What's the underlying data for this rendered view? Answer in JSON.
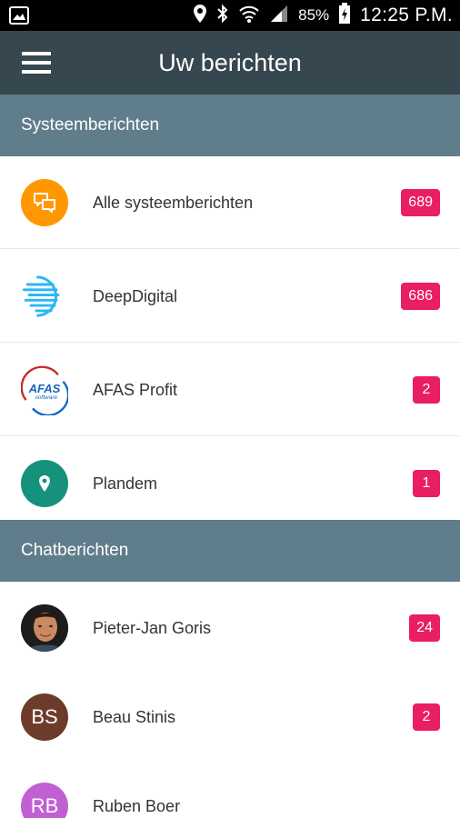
{
  "status_bar": {
    "battery": "85%",
    "time": "12:25 P.M."
  },
  "header": {
    "title": "Uw berichten"
  },
  "sections": {
    "system": {
      "title": "Systeemberichten",
      "items": [
        {
          "label": "Alle systeemberichten",
          "count": "689",
          "icon": "chat-bubbles-icon",
          "color": "#ff9800"
        },
        {
          "label": "DeepDigital",
          "count": "686",
          "icon": "deepdigital-logo",
          "color": "#29b6f6"
        },
        {
          "label": "AFAS Profit",
          "count": "2",
          "icon": "afas-software-logo",
          "color": "#1565c0"
        },
        {
          "label": "Plandem",
          "count": "1",
          "icon": "map-pin-icon",
          "color": "#16917b"
        }
      ]
    },
    "chat": {
      "title": "Chatberichten",
      "items": [
        {
          "label": "Pieter-Jan Goris",
          "count": "24",
          "icon": "user-photo-avatar"
        },
        {
          "label": "Beau Stinis",
          "count": "2",
          "initials": "BS",
          "color": "#6d3b2c"
        },
        {
          "label": "Ruben Boer",
          "count": "",
          "initials": "RB",
          "color": "#c15fd3"
        }
      ]
    }
  },
  "colors": {
    "app_bar": "#37474f",
    "section_header": "#607d8b",
    "badge": "#e91e63"
  },
  "afas_logo": {
    "brand": "AFAS",
    "sub": "software"
  }
}
